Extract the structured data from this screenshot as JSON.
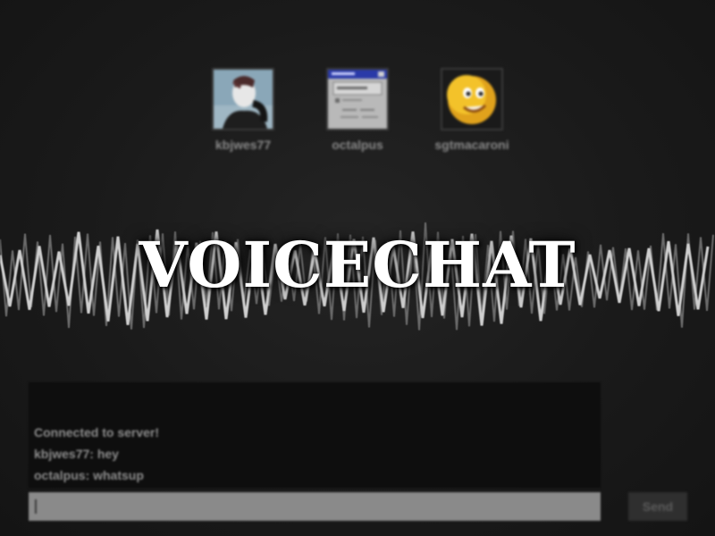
{
  "title": "VOICECHAT",
  "users": [
    {
      "name": "kbjwes77",
      "avatar_icon": "person-photo-icon"
    },
    {
      "name": "octalpus",
      "avatar_icon": "window-screenshot-icon"
    },
    {
      "name": "sgtmacaroni",
      "avatar_icon": "smiley-face-icon"
    }
  ],
  "chat": {
    "messages": [
      "Connected to server!",
      "kbjwes77: hey",
      "octalpus: whatsup"
    ],
    "input_value": "",
    "send_label": "Send"
  },
  "colors": {
    "background": "#1b1b1b",
    "title": "#ffffff",
    "chat_text": "#8d8d8d",
    "input_bg": "#8a8a8a"
  }
}
